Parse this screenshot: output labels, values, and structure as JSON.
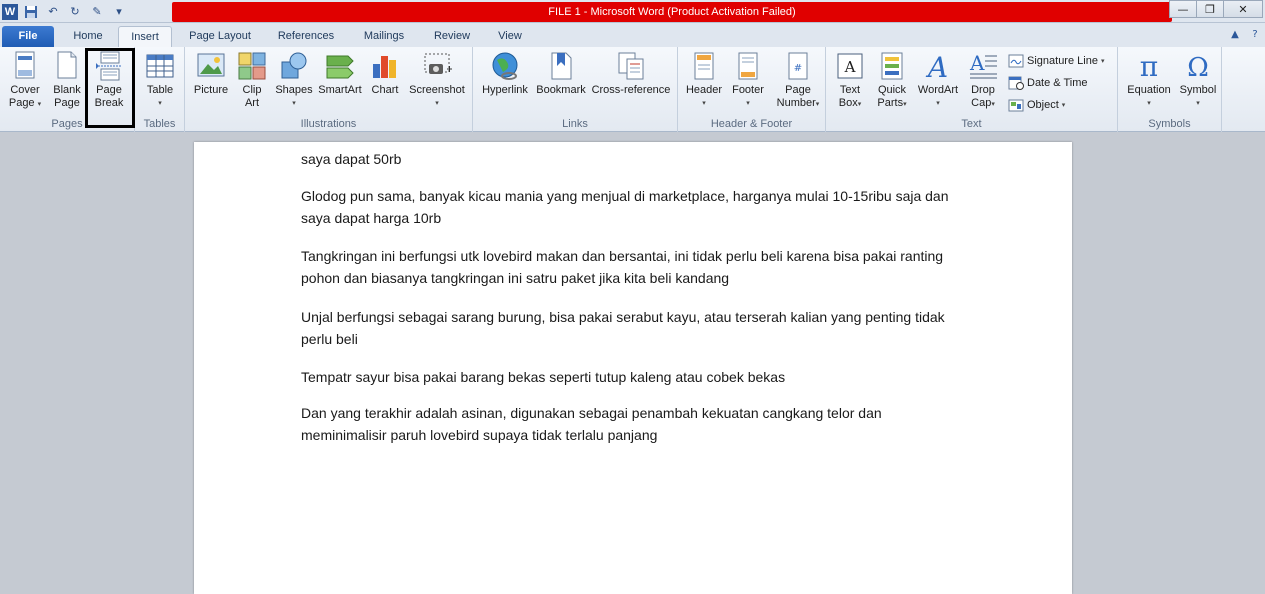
{
  "window": {
    "title": "FILE 1  -  Microsoft Word (Product Activation Failed)",
    "app_icon": "W"
  },
  "tabs": [
    {
      "label": "File"
    },
    {
      "label": "Home"
    },
    {
      "label": "Insert"
    },
    {
      "label": "Page Layout"
    },
    {
      "label": "References"
    },
    {
      "label": "Mailings"
    },
    {
      "label": "Review"
    },
    {
      "label": "View"
    }
  ],
  "ribbon": {
    "pages": {
      "label": "Pages",
      "cover": [
        "Cover",
        "Page"
      ],
      "blank": [
        "Blank",
        "Page"
      ],
      "break": [
        "Page",
        "Break"
      ]
    },
    "tables": {
      "label": "Tables",
      "table": "Table"
    },
    "illustrations": {
      "label": "Illustrations",
      "picture": "Picture",
      "clipart": [
        "Clip",
        "Art"
      ],
      "shapes": "Shapes",
      "smartart": "SmartArt",
      "chart": "Chart",
      "screenshot": "Screenshot"
    },
    "links": {
      "label": "Links",
      "hyperlink": "Hyperlink",
      "bookmark": "Bookmark",
      "crossref": "Cross-reference"
    },
    "headerfooter": {
      "label": "Header & Footer",
      "header": "Header",
      "footer": "Footer",
      "pagenumber": [
        "Page",
        "Number"
      ]
    },
    "text": {
      "label": "Text",
      "textbox": [
        "Text",
        "Box"
      ],
      "quickparts": [
        "Quick",
        "Parts"
      ],
      "wordart": "WordArt",
      "dropcap": [
        "Drop",
        "Cap"
      ],
      "signature": "Signature Line",
      "datetime": "Date & Time",
      "object": "Object"
    },
    "symbols": {
      "label": "Symbols",
      "equation": "Equation",
      "symbol": "Symbol"
    }
  },
  "document": {
    "paragraphs": [
      "saya dapat 50rb",
      "Glodog pun sama, banyak kicau mania yang menjual di marketplace, harganya mulai 10-15ribu saja dan saya dapat harga 10rb",
      "Tangkringan ini berfungsi utk lovebird makan dan bersantai, ini tidak perlu beli karena bisa pakai ranting pohon dan biasanya tangkringan ini satru paket jika kita beli kandang",
      "Unjal berfungsi sebagai sarang burung, bisa pakai serabut kayu, atau terserah kalian yang penting tidak perlu beli",
      "Tempatr sayur bisa pakai barang bekas seperti tutup  kaleng atau cobek bekas",
      "Dan yang terakhir adalah asinan, digunakan sebagai penambah kekuatan cangkang telor dan meminimalisir paruh lovebird supaya tidak terlalu panjang"
    ]
  },
  "colors": {
    "title_bar_alert": "#e00000",
    "file_tab": "#2b5fb4",
    "ribbon_bg": "#eef2f7"
  }
}
